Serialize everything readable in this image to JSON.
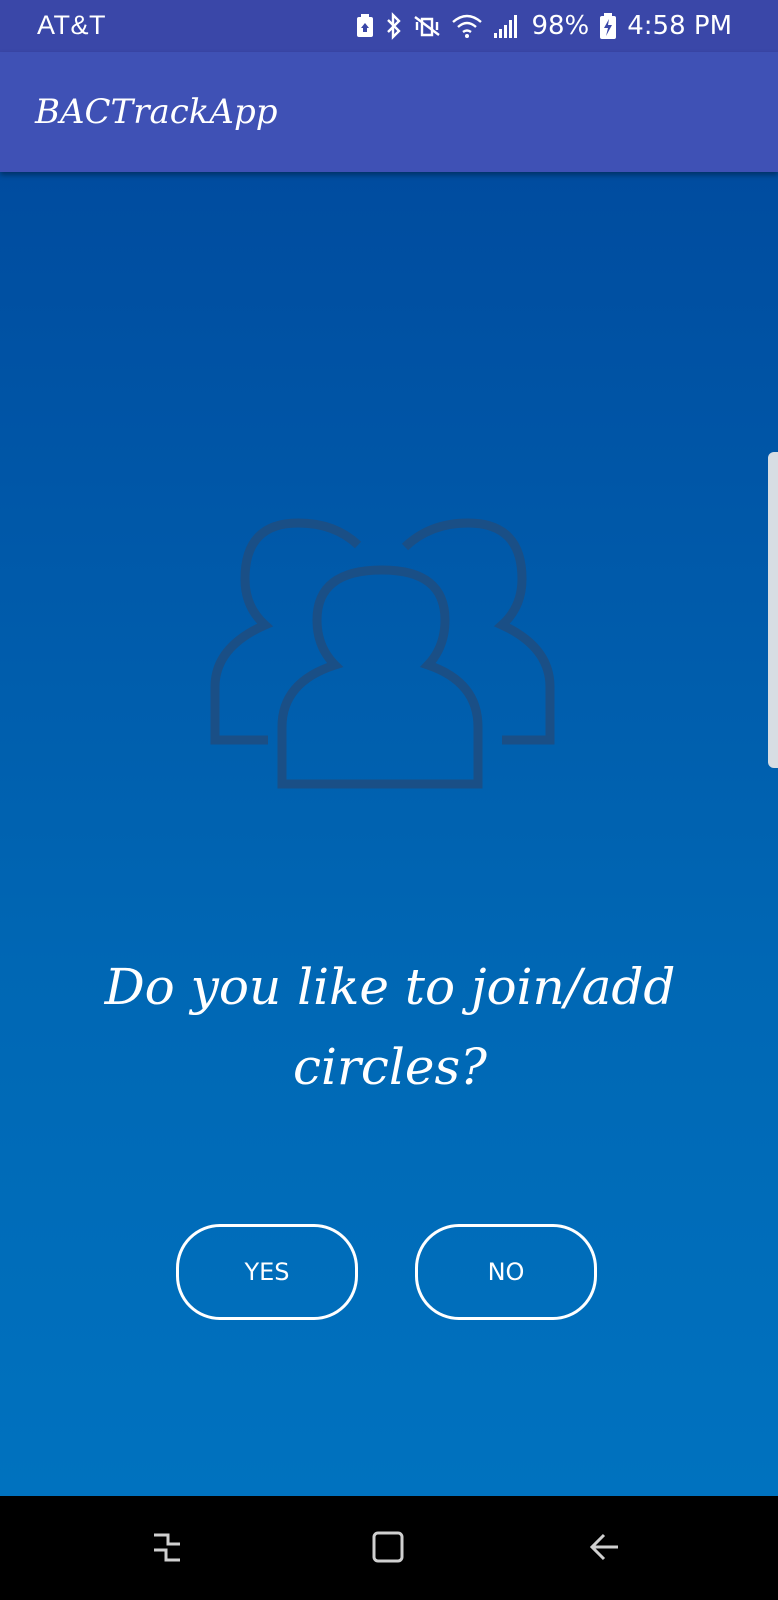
{
  "status_bar": {
    "carrier": "AT&T",
    "battery_percent": "98%",
    "time": "4:58 PM",
    "icons": [
      "battery-saver-icon",
      "bluetooth-icon",
      "vibrate-icon",
      "wifi-icon",
      "signal-icon",
      "battery-charging-icon"
    ]
  },
  "app_bar": {
    "title": "BACTrackApp"
  },
  "main": {
    "illustration_icon": "people-group-icon",
    "question": "Do you like to join/add circles?",
    "yes_label": "YES",
    "no_label": "NO"
  },
  "nav_bar": {
    "icons": [
      "recents-icon",
      "home-icon",
      "back-icon"
    ]
  },
  "colors": {
    "status_bar": "#3a47a8",
    "app_bar": "#3f51b5",
    "content_top": "#004c9f",
    "content_bottom": "#0072bf",
    "icon_stroke": "#1a4f86"
  }
}
